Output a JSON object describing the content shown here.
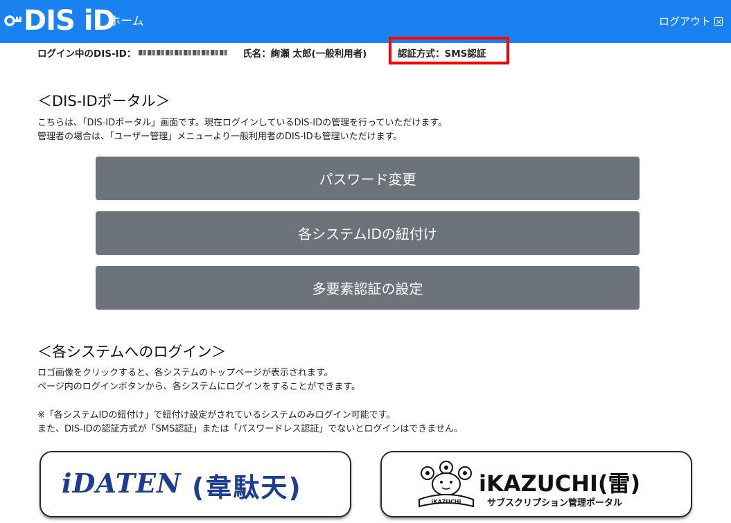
{
  "header": {
    "logo_text": "DIS iD",
    "home_label": "ホーム",
    "logout_label": "ログアウト"
  },
  "user_info": {
    "dis_id_label": "ログイン中のDIS-ID：",
    "name_label": "氏名：絢瀬 太郎(一般利用者)",
    "auth_method": "認証方式：SMS認証"
  },
  "portal": {
    "title": "＜DIS-IDポータル＞",
    "desc_line1": "こちらは、「DIS-IDポータル」画面です。現在ログインしているDIS-IDの管理を行っていただけます。",
    "desc_line2": "管理者の場合は、「ユーザー管理」メニューより一般利用者のDIS-IDも管理いただけます。",
    "buttons": [
      {
        "label": "パスワード変更"
      },
      {
        "label": "各システムIDの紐付け"
      },
      {
        "label": "多要素認証の設定"
      }
    ]
  },
  "systems": {
    "title": "＜各システムへのログイン＞",
    "desc_line1": "ロゴ画像をクリックすると、各システムのトップページが表示されます。",
    "desc_line2": "ページ内のログインボタンから、各システムにログインをすることができます。",
    "note_line1": "※「各システムIDの紐付け」で紐付け設定がされているシステムのみログイン可能です。",
    "note_line2": "また、DIS-IDの認証方式が「SMS認証」または「パスワードレス認証」でないとログインはできません。",
    "cards": [
      {
        "logo_latin": "iDATEN",
        "logo_kanji": "(韋駄天)"
      },
      {
        "logo_title": "iKAZUCHI(雷)",
        "logo_sub": "サブスクリプション管理ポータル",
        "mascot_label": "iKAZUCHI"
      }
    ]
  },
  "colors": {
    "header_bg": "#1a82f0",
    "button_bg": "#6c737b",
    "highlight_border": "#ff0000",
    "idaten_blue": "#1d3e8f"
  }
}
